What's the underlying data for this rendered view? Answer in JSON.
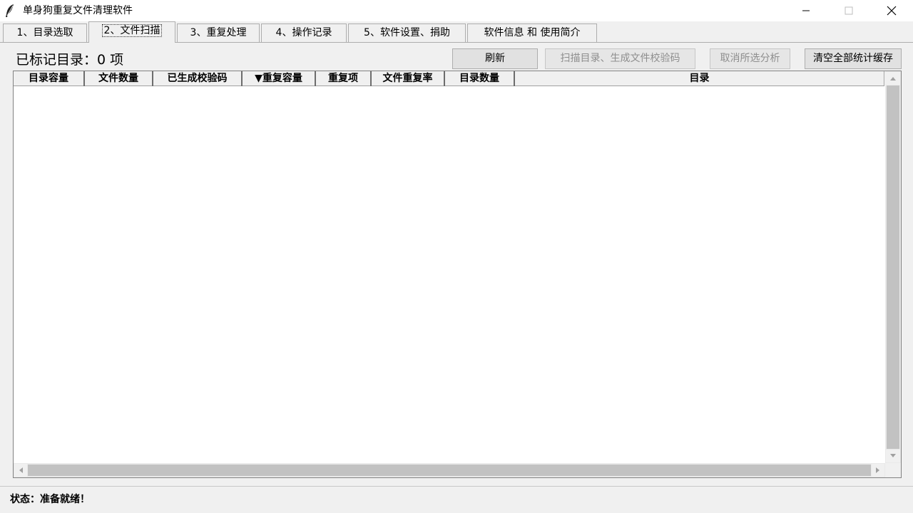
{
  "window": {
    "title": "单身狗重复文件清理软件",
    "icon": "feather-icon"
  },
  "tabs": [
    {
      "label": "1、目录选取",
      "active": false
    },
    {
      "label": "2、文件扫描",
      "active": true
    },
    {
      "label": "3、重复处理",
      "active": false
    },
    {
      "label": "4、操作记录",
      "active": false
    },
    {
      "label": "5、软件设置、捐助",
      "active": false
    },
    {
      "label": "软件信息 和 使用简介",
      "active": false
    }
  ],
  "toolbar": {
    "marked_label": "已标记目录：0 项",
    "refresh_label": "刷新",
    "scan_label": "扫描目录、生成文件校验码",
    "scan_enabled": false,
    "cancel_label": "取消所选分析",
    "cancel_enabled": false,
    "clear_label": "清空全部统计缓存"
  },
  "table": {
    "columns": [
      "目录容量",
      "文件数量",
      "已生成校验码",
      "▼重复容量",
      "重复项",
      "文件重复率",
      "目录数量",
      "目录"
    ],
    "sort_column": "重复容量",
    "sort_order": "descending",
    "rows": []
  },
  "status": {
    "text": "状态：准备就绪！"
  },
  "colors": {
    "window_bg": "#f0f0f0",
    "button_bg": "#e1e1e1",
    "disabled_text": "#8e8e8e",
    "scrollbar_thumb": "#c2c2c2"
  }
}
